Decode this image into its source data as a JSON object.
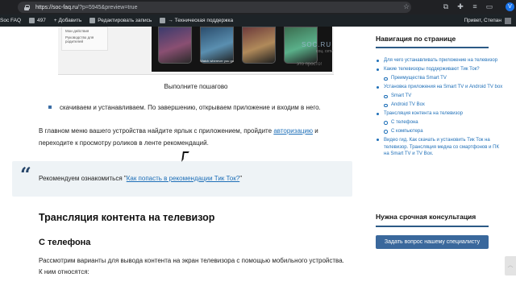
{
  "browser": {
    "url_host": "https://soc-faq.ru",
    "url_path": "/?p=5945&preview=true",
    "avatar_letter": "V",
    "dots": [
      "#ff5f57",
      "#febc2e",
      "#28c840"
    ]
  },
  "adminbar": {
    "site": "Soc FAQ",
    "comments": "497",
    "add": "+ Добавить",
    "edit": "Редактировать запись",
    "support": "→ Техническая поддержка",
    "greeting": "Привет, Степан"
  },
  "article": {
    "menu_items": [
      "Мои действия",
      "Руководство для родителей"
    ],
    "phone_caption": "Watch wherever you go",
    "watermark": "SOC.RU",
    "watermark_sub": "соц. сети",
    "watermark_sub2": "это просто!",
    "caption": "Выполните пошагово",
    "bullet": "скачиваем и устанавливаем. По завершению, открываем приложение и входим в него.",
    "para_before": "В главном меню вашего устройства найдите ярлык с приложением, пройдите",
    "para_link": "авторизацию",
    "para_after": "и переходите к просмотру роликов в ленте рекомендаций.",
    "quote_mark": "“",
    "quote_prefix": "Рекомендуем ознакомиться \"",
    "quote_link": "Как попасть в рекомендации Тик Ток?",
    "quote_suffix": "\"",
    "h2": "Трансляция контента на телевизор",
    "h3": "С телефона",
    "p2_line1": "Рассмотрим варианты для вывода контента на экран телевизора с помощью мобильного устройства.",
    "p2_line2": "К ним относятся:"
  },
  "sidebar": {
    "nav_title": "Навигация по странице",
    "toc": [
      {
        "label": "Для чего устанавливать приложение на телевизор",
        "sub": false
      },
      {
        "label": "Какие телевизоры поддерживают Тик Ток?",
        "sub": false
      },
      {
        "label": "Преимущества Smart TV",
        "sub": true
      },
      {
        "label": "Установка приложения на Smart TV и Android TV box",
        "sub": false
      },
      {
        "label": "Smart TV",
        "sub": true
      },
      {
        "label": "Android TV Box",
        "sub": true
      },
      {
        "label": "Трансляция контента на телевизор",
        "sub": false
      },
      {
        "label": "С телефона",
        "sub": true
      },
      {
        "label": "С компьютера",
        "sub": true
      },
      {
        "label": "Видео гид. Как скачать и установить Тик Ток на телевизор. Трансляция медиа со смартфонов и ПК на Smart TV и TV Box.",
        "sub": false
      }
    ],
    "consult_title": "Нужна срочная консультация",
    "ask_button": "Задать вопрос нашему специалисту"
  }
}
